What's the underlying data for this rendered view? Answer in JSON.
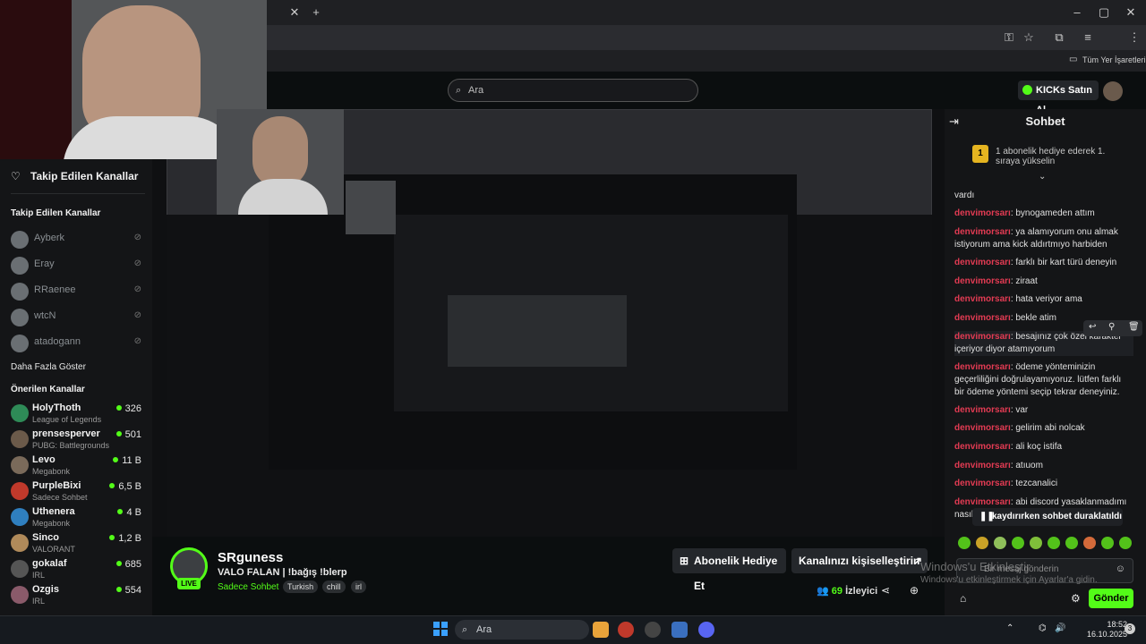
{
  "browser": {
    "bookmark": "Tüm Yer İşaretleri"
  },
  "header": {
    "search_placeholder": "Ara",
    "buy_kicks": "KICKs Satın Al"
  },
  "sidebar": {
    "header": "Takip Edilen Kanallar",
    "section_followed": "Takip Edilen Kanallar",
    "followed": [
      {
        "name": "Ayberk"
      },
      {
        "name": "Eray"
      },
      {
        "name": "RRaenee"
      },
      {
        "name": "wtcN"
      },
      {
        "name": "atadogann"
      }
    ],
    "show_more": "Daha Fazla Göster",
    "section_recommended": "Önerilen Kanallar",
    "recommended": [
      {
        "name": "HolyThoth",
        "category": "League of Legends",
        "viewers": "326",
        "color": "#2e8b57"
      },
      {
        "name": "prensesperver",
        "category": "PUBG: Battlegrounds",
        "viewers": "501",
        "color": "#6b5a4a"
      },
      {
        "name": "Levo",
        "category": "Megabonk",
        "viewers": "11 B",
        "color": "#7a6a5a"
      },
      {
        "name": "PurpleBixi",
        "category": "Sadece Sohbet",
        "viewers": "6,5 B",
        "color": "#c0392b"
      },
      {
        "name": "Uthenera",
        "category": "Megabonk",
        "viewers": "4 B",
        "color": "#2f7fbf"
      },
      {
        "name": "Sinco",
        "category": "VALORANT",
        "viewers": "1,2 B",
        "color": "#b08a5a"
      },
      {
        "name": "gokalaf",
        "category": "IRL",
        "viewers": "685",
        "color": "#555"
      },
      {
        "name": "Ozgis",
        "category": "IRL",
        "viewers": "554",
        "color": "#8a5a6a"
      }
    ]
  },
  "channel": {
    "name": "SRguness",
    "live": "LIVE",
    "title": "VALO FALAN | !bağış !blerp",
    "category": "Sadece Sohbet",
    "tags": [
      "Turkish",
      "chill",
      "irl"
    ],
    "gift_sub": "Abonelik Hediye Et",
    "customize": "Kanalınızı kişiselleştirin",
    "viewers": "69",
    "viewers_label": "İzleyici"
  },
  "chat": {
    "title": "Sohbet",
    "pinned_count": "1",
    "pinned_text": "1 abonelik hediye ederek 1. sıraya yükselin",
    "messages": [
      {
        "user": "",
        "text": "vardı"
      },
      {
        "user": "denvimorsarı",
        "text": "bynogameden attım"
      },
      {
        "user": "denvimorsarı",
        "text": "ya alamıyorum onu almak istiyorum ama kick aldırtmıyo harbiden"
      },
      {
        "user": "denvimorsarı",
        "text": "farklı bir kart türü deneyin"
      },
      {
        "user": "denvimorsarı",
        "text": "ziraat"
      },
      {
        "user": "denvimorsarı",
        "text": "hata veriyor ama"
      },
      {
        "user": "denvimorsarı",
        "text": "bekle atim"
      },
      {
        "user": "denvimorsarı",
        "text": "besajınız çok özel karakter içeriyor diyor atamıyorum"
      },
      {
        "user": "denvimorsarı",
        "text": "ödeme yönteminizin geçerliliğini doğrulayamıyoruz. lütfen farklı bir ödeme yöntemi seçip tekrar deneyiniz."
      },
      {
        "user": "denvimorsarı",
        "text": "var"
      },
      {
        "user": "denvimorsarı",
        "text": "gelirim abi nolcak"
      },
      {
        "user": "denvimorsarı",
        "text": "ali koç istifa"
      },
      {
        "user": "denvimorsarı",
        "text": "atıuom"
      },
      {
        "user": "denvimorsarı",
        "text": "tezcanalici"
      },
      {
        "user": "denvimorsarı",
        "text": "abi discord yasaklanmadımı nasıl kullanıyon"
      }
    ],
    "paused": "kaydırırken sohbet duraklatıldı",
    "input_placeholder": "Bir mesaj gönderin",
    "send": "Gönder"
  },
  "watermark": {
    "line1": "Windows'u Etkinleştir",
    "line2": "Windows'u etkinleştirmek için Ayarlar'a gidin."
  },
  "taskbar": {
    "search": "Ara",
    "time": "18:52",
    "date": "16.10.2025",
    "notifications": "3"
  }
}
